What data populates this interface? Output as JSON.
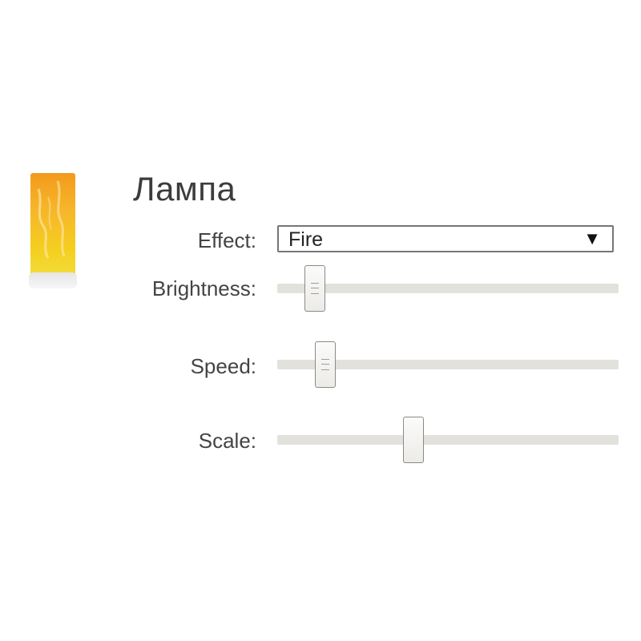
{
  "title": "Лампа",
  "effect": {
    "label": "Effect:",
    "selected": "Fire",
    "arrow": "▼"
  },
  "sliders": {
    "brightness": {
      "label": "Brightness:",
      "level_percent": 11,
      "grip": true
    },
    "speed": {
      "label": "Speed:",
      "level_percent": 14,
      "grip": true
    },
    "scale": {
      "label": "Scale:",
      "level_percent": 40,
      "grip": false
    }
  },
  "lamp_icon": "flame-lamp-icon",
  "colors": {
    "flame_top": "#f4a81e",
    "flame_bottom": "#f3d11d",
    "track": "#e2e1dc",
    "thumb_border": "#8a8a86"
  }
}
